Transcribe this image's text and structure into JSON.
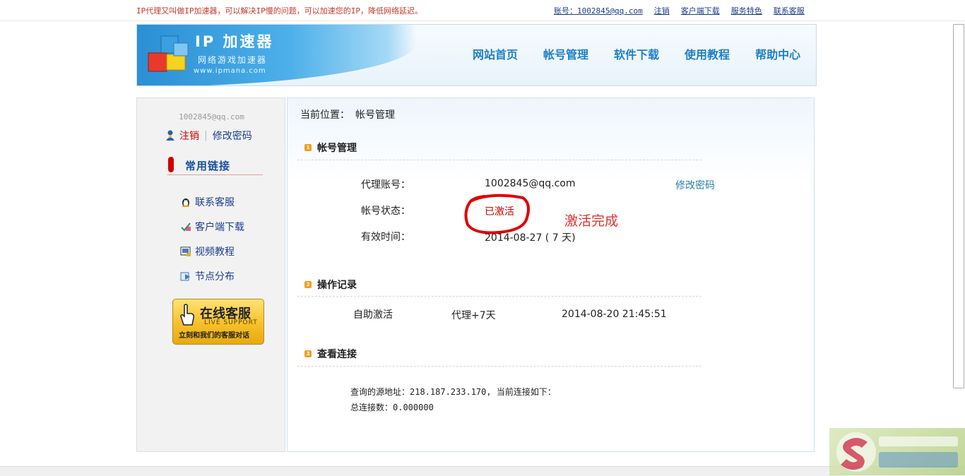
{
  "topbar": {
    "notice": "IP代理又叫做IP加速器，可以解决IP慢的问题，可以加速您的IP，降低网络延迟。",
    "account": "账号：1002845@qq.com",
    "logout": "注销",
    "client_download": "客户端下载",
    "features": "服务特色",
    "contact": "联系客服"
  },
  "header": {
    "logo_title": "IP 加速器",
    "logo_subtitle": "网络游戏加速器",
    "logo_url": "www.ipmana.com",
    "nav": [
      "网站首页",
      "帐号管理",
      "软件下载",
      "使用教程",
      "帮助中心"
    ]
  },
  "sidebar": {
    "email": "1002845@qq.com",
    "logout": "注销",
    "change_password": "修改密码",
    "quick_links_title": "常用链接",
    "links": [
      {
        "label": "联系客服",
        "icon": "qq-penguin-icon"
      },
      {
        "label": "客户端下载",
        "icon": "download-icon"
      },
      {
        "label": "视频教程",
        "icon": "video-icon"
      },
      {
        "label": "节点分布",
        "icon": "node-icon"
      }
    ],
    "support": {
      "big": "在线客服",
      "en": "LIVE SUPPORT",
      "small": "立刻和我们的客服对话"
    }
  },
  "main": {
    "crumb_label": "当前位置：",
    "crumb_value": "帐号管理",
    "account_section": {
      "title": "帐号管理",
      "proxy_account_label": "代理账号：",
      "proxy_account_value": "1002845@qq.com",
      "change_password": "修改密码",
      "status_label": "帐号状态：",
      "status_value": "已激活",
      "valid_label": "有效时间：",
      "valid_value": "2014-08-27 ( 7 天)",
      "annotation": "激活完成"
    },
    "records_section": {
      "title": "操作记录",
      "record": {
        "action": "自助激活",
        "detail": "代理+7天",
        "time": "2014-08-20 21:45:51"
      }
    },
    "connections_section": {
      "title": "查看连接",
      "source_line": "查询的源地址：218.187.233.170, 当前连接如下：",
      "total_line": "总连接数：0.000000"
    }
  },
  "colors": {
    "accent_blue": "#1e7fc6",
    "link_blue": "#1a3e8c",
    "alert_red": "#c00000",
    "section_orange": "#f0a020"
  }
}
